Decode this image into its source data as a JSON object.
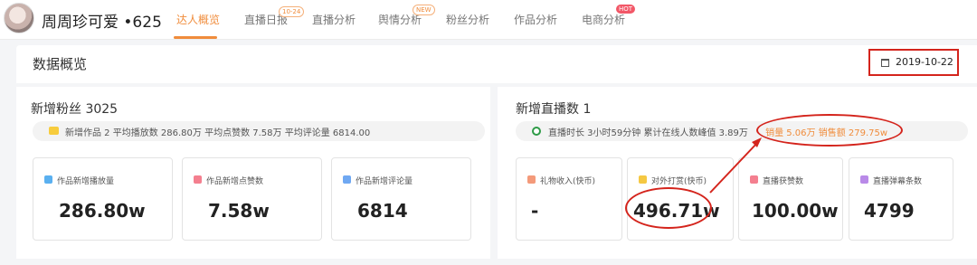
{
  "header": {
    "username": "周周珍可爱 •625",
    "tabs": [
      {
        "label": "达人概览"
      },
      {
        "label": "直播日报",
        "badge": "10-24"
      },
      {
        "label": "直播分析"
      },
      {
        "label": "舆情分析",
        "badge": "NEW"
      },
      {
        "label": "粉丝分析"
      },
      {
        "label": "作品分析"
      },
      {
        "label": "电商分析",
        "badge": "HOT"
      }
    ]
  },
  "section": {
    "title": "数据概览",
    "date": "2019-10-22"
  },
  "left_panel": {
    "title": "新增粉丝 3025",
    "info": "新增作品 2   平均播放数 286.80万   平均点赞数 7.58万   平均评论量 6814.00",
    "cards": [
      {
        "label": "作品新增播放量",
        "value": "286.80w",
        "icon": "play-icon",
        "icon_color": "#5ab0f0"
      },
      {
        "label": "作品新增点赞数",
        "value": "7.58w",
        "icon": "thumb-up-icon",
        "icon_color": "#f47f8f"
      },
      {
        "label": "作品新增评论量",
        "value": "6814",
        "icon": "comment-icon",
        "icon_color": "#6fa8f2"
      }
    ]
  },
  "right_panel": {
    "title": "新增直播数 1",
    "info_prefix": "直播时长 3小时59分钟   累计在线人数峰值 3.89万",
    "info_sales": "销量 5.06万  销售额 279.75w",
    "cards": [
      {
        "label": "礼物收入(快币)",
        "value": "-",
        "icon": "gift-icon",
        "icon_color": "#f49a7a"
      },
      {
        "label": "对外打赏(快币)",
        "value": "496.71w",
        "icon": "coin-icon",
        "icon_color": "#f5c842"
      },
      {
        "label": "直播获赞数",
        "value": "100.00w",
        "icon": "like-icon",
        "icon_color": "#f47f8f"
      },
      {
        "label": "直播弹幕条数",
        "value": "4799",
        "icon": "danmaku-icon",
        "icon_color": "#b98ae8"
      }
    ]
  }
}
